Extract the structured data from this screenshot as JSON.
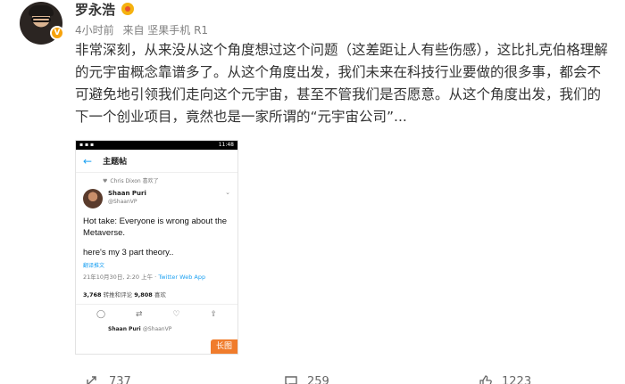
{
  "user": {
    "name": "罗永浩"
  },
  "meta": {
    "time": "4小时前",
    "source": "来自 坚果手机 R1"
  },
  "post": {
    "text": "非常深刻，从来没从这个角度想过这个问题（这差距让人有些伤感），这比扎克伯格理解的元宇宙概念靠谱多了。从这个角度出发，我们未来在科技行业要做的很多事，都会不可避免地引领我们走向这个元宇宙，甚至不管我们是否愿意。从这个角度出发，我们的下一个创业项目，竟然也是一家所谓的“元宇宙公司”..."
  },
  "screenshot": {
    "status_time": "11:48",
    "nav_title": "主题帖",
    "liked_by": "Chris Dixon 喜欢了",
    "tweet": {
      "author": "Shaan Puri",
      "handle": "@ShaanVP",
      "line1": "Hot take: Everyone is wrong about the Metaverse.",
      "line2": "here's my 3 part theory..",
      "translate": "翻译推文",
      "date": "21年10月30日, 2:20 上午 · ",
      "app": "Twitter Web App",
      "retweets": "3,768",
      "retweets_label": " 转推和评论  ",
      "likes": "9,808",
      "likes_label": " 喜欢"
    },
    "next_author": "Shaan Puri",
    "next_handle": "@ShaanVP",
    "badge": "长图"
  },
  "actions": {
    "reposts": "737",
    "comments": "259",
    "likes": "1223"
  },
  "colors": {
    "accent": "#f07c2c",
    "twitter": "#1da1f2",
    "vip": "#f7a30c"
  }
}
